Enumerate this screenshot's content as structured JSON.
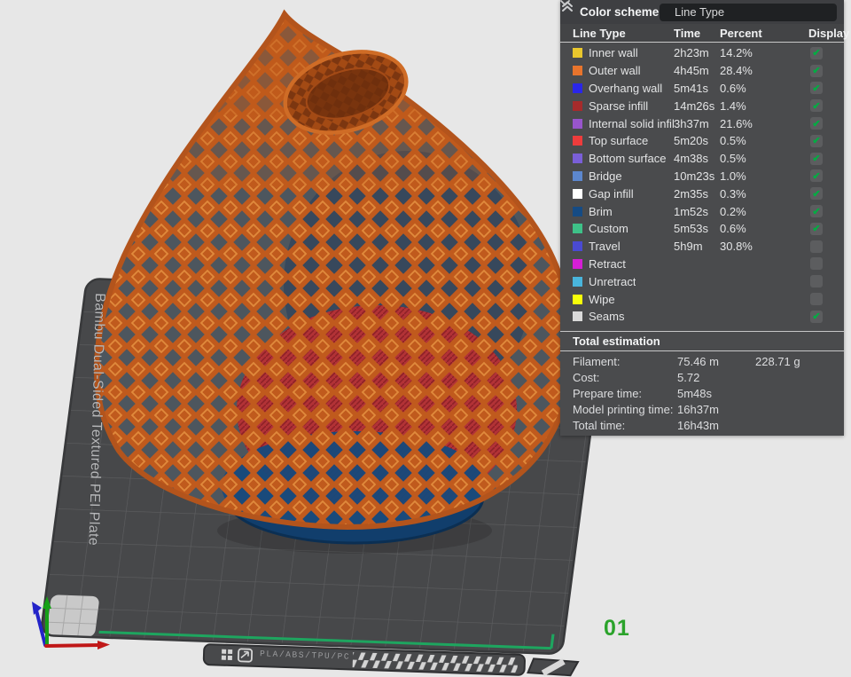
{
  "panel": {
    "title": "Color scheme",
    "dropdown": {
      "value": "Line Type"
    },
    "table": {
      "headers": [
        "Line Type",
        "Time",
        "Percent",
        "Display"
      ],
      "rows": [
        {
          "label": "Inner wall",
          "color": "#E9C72D",
          "time": "2h23m",
          "percent": "14.2%",
          "checked": true
        },
        {
          "label": "Outer wall",
          "color": "#E8742C",
          "time": "4h45m",
          "percent": "28.4%",
          "checked": true
        },
        {
          "label": "Overhang wall",
          "color": "#2A26E8",
          "time": "5m41s",
          "percent": "0.6%",
          "checked": true
        },
        {
          "label": "Sparse infill",
          "color": "#A62B2B",
          "time": "14m26s",
          "percent": "1.4%",
          "checked": true
        },
        {
          "label": "Internal solid infill",
          "color": "#9855CC",
          "time": "3h37m",
          "percent": "21.6%",
          "checked": true
        },
        {
          "label": "Top surface",
          "color": "#EE3C3C",
          "time": "5m20s",
          "percent": "0.5%",
          "checked": true
        },
        {
          "label": "Bottom surface",
          "color": "#7A5FD8",
          "time": "4m38s",
          "percent": "0.5%",
          "checked": true
        },
        {
          "label": "Bridge",
          "color": "#5C87CE",
          "time": "10m23s",
          "percent": "1.0%",
          "checked": true
        },
        {
          "label": "Gap infill",
          "color": "#FFFFFF",
          "time": "2m35s",
          "percent": "0.3%",
          "checked": true
        },
        {
          "label": "Brim",
          "color": "#154B84",
          "time": "1m52s",
          "percent": "0.2%",
          "checked": true
        },
        {
          "label": "Custom",
          "color": "#3EC188",
          "time": "5m53s",
          "percent": "0.6%",
          "checked": true
        },
        {
          "label": "Travel",
          "color": "#4A4AD2",
          "time": "5h9m",
          "percent": "30.8%",
          "checked": false
        },
        {
          "label": "Retract",
          "color": "#D51ED5",
          "time": "",
          "percent": "",
          "checked": false
        },
        {
          "label": "Unretract",
          "color": "#49B5DC",
          "time": "",
          "percent": "",
          "checked": false
        },
        {
          "label": "Wipe",
          "color": "#F6FF0A",
          "time": "",
          "percent": "",
          "checked": false
        },
        {
          "label": "Seams",
          "color": "#D9D9D9",
          "time": "",
          "percent": "",
          "checked": true
        }
      ]
    },
    "total_estimation": {
      "title": "Total estimation",
      "rows": [
        {
          "label": "Filament:",
          "value": "75.46 m",
          "value2": "228.71 g"
        },
        {
          "label": "Cost:",
          "value": "5.72",
          "value2": ""
        },
        {
          "label": "Prepare time:",
          "value": "5m48s",
          "value2": ""
        },
        {
          "label": "Model printing time:",
          "value": "16h37m",
          "value2": ""
        },
        {
          "label": "Total time:",
          "value": "16h43m",
          "value2": ""
        }
      ]
    }
  },
  "viewport": {
    "plate_label": "Bambu Dual-Sided Textured PEI Plate",
    "plate_number": "01",
    "plate_bar_text": "PLA/ABS/TPU/PC"
  },
  "colors": {
    "check_green": "#00AE42",
    "plate_number_green": "#2BA32B",
    "model_orange": "#C25A1B",
    "infill_red": "#B23236",
    "brim_navy": "#12406E"
  }
}
